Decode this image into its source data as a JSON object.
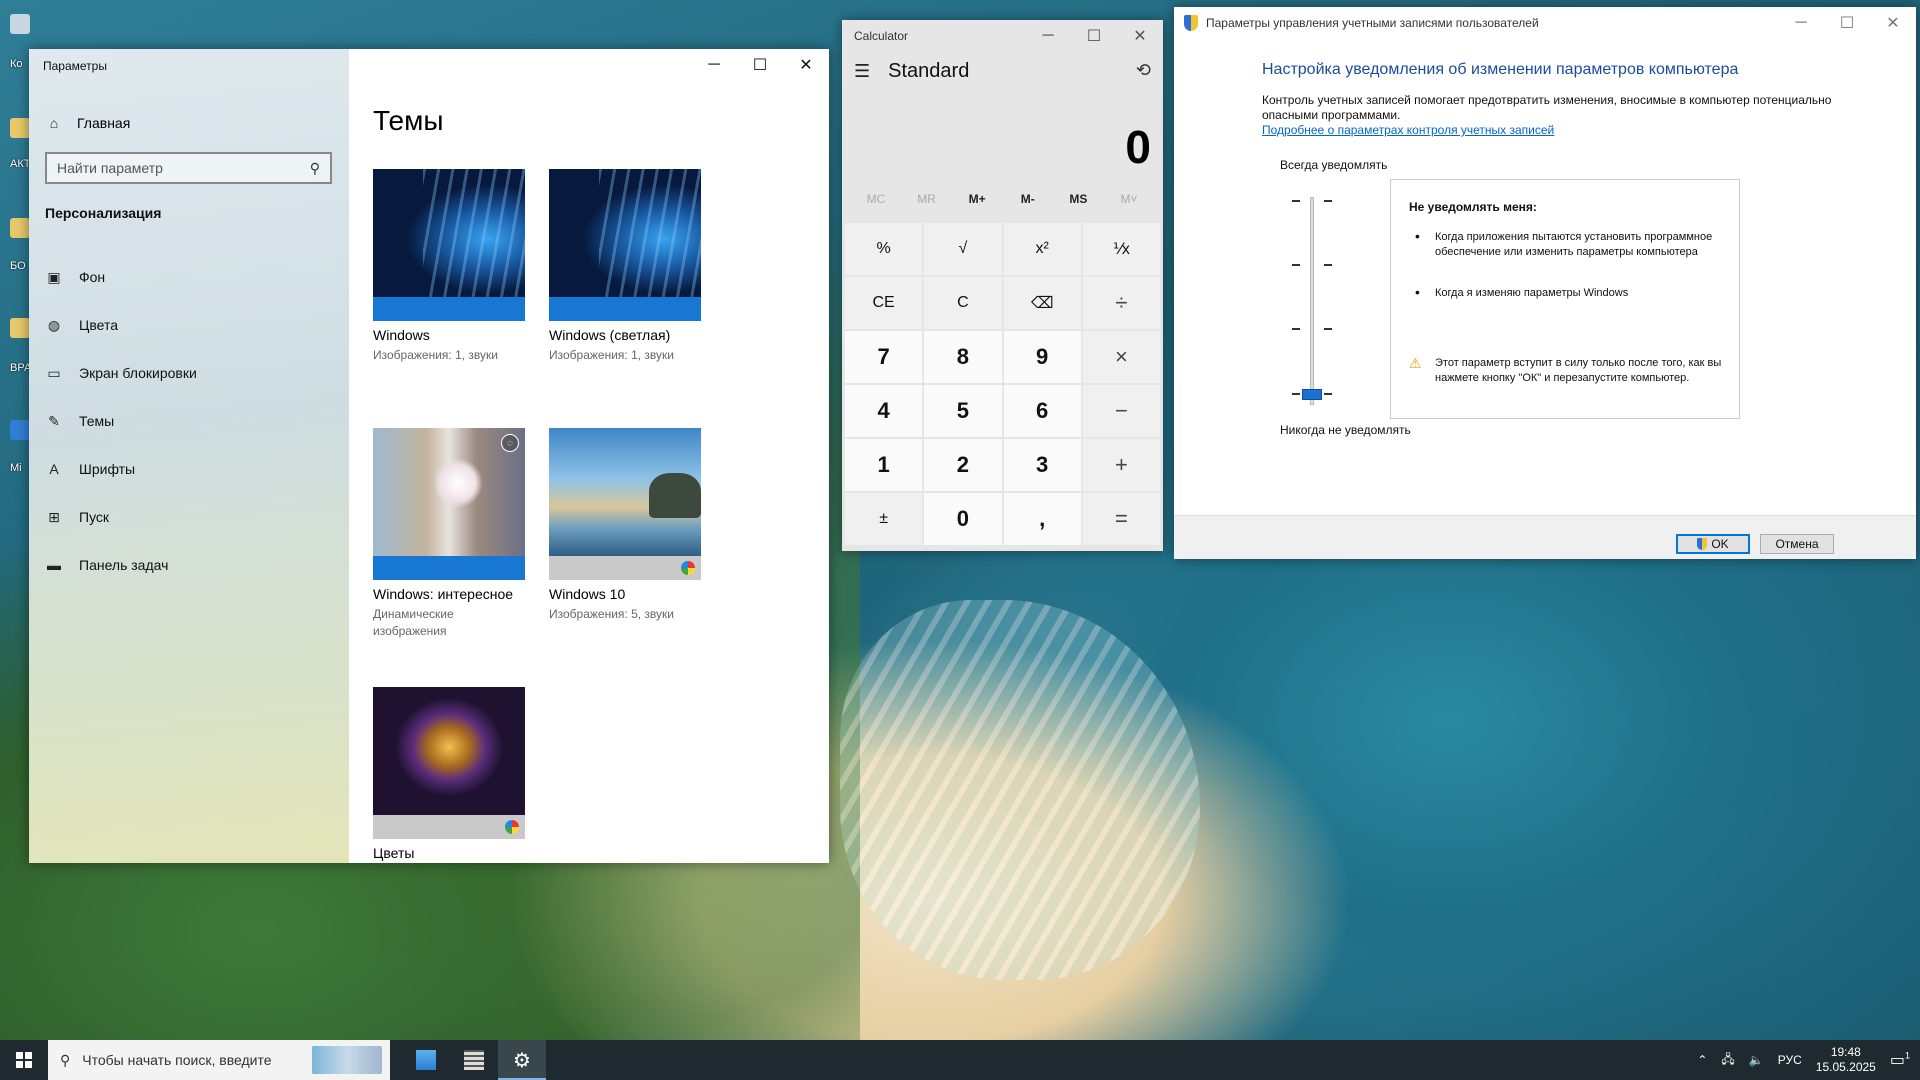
{
  "settings": {
    "title": "Параметры",
    "home": "Главная",
    "search_placeholder": "Найти параметр",
    "section": "Персонализация",
    "nav": [
      "Фон",
      "Цвета",
      "Экран блокировки",
      "Темы",
      "Шрифты",
      "Пуск",
      "Панель задач"
    ],
    "heading": "Темы",
    "themes": [
      {
        "name": "Windows",
        "sub": "Изображения: 1, звуки"
      },
      {
        "name": "Windows (светлая)",
        "sub": "Изображения: 1, звуки"
      },
      {
        "name": "Windows: интересное",
        "sub": "Динамические изображения"
      },
      {
        "name": "Windows 10",
        "sub": "Изображения: 5, звуки"
      },
      {
        "name": "Цветы",
        "sub": ""
      }
    ]
  },
  "calculator": {
    "title": "Calculator",
    "mode": "Standard",
    "display": "0",
    "memory": [
      "MC",
      "MR",
      "M+",
      "M-",
      "MS",
      "M˅"
    ],
    "keys": [
      "%",
      "√",
      "x²",
      "⅟x",
      "CE",
      "C",
      "⌫",
      "÷",
      "7",
      "8",
      "9",
      "×",
      "4",
      "5",
      "6",
      "−",
      "1",
      "2",
      "3",
      "+",
      "±",
      "0",
      ",",
      "="
    ]
  },
  "uac": {
    "title": "Параметры управления учетными записями пользователей",
    "heading": "Настройка уведомления об изменении параметров компьютера",
    "desc": "Контроль учетных записей помогает предотвратить изменения, вносимые в компьютер потенциально опасными программами.",
    "link": "Подробнее о параметрах контроля учетных записей",
    "always": "Всегда уведомлять",
    "never": "Никогда не уведомлять",
    "slider_level": 0,
    "box_title": "Не уведомлять меня:",
    "bullets": [
      "Когда приложения пытаются установить программное обеспечение или изменить параметры компьютера",
      "Когда я изменяю параметры Windows"
    ],
    "warning": "Этот параметр вступит в силу только после того, как вы нажмете кнопку \"ОК\" и перезапустите компьютер.",
    "ok": "OK",
    "cancel": "Отмена"
  },
  "taskbar": {
    "search_placeholder": "Чтобы начать поиск, введите",
    "lang": "РУС",
    "time": "19:48",
    "date": "15.05.2025",
    "notification_count": "1"
  },
  "desktop": {
    "labels": [
      "Ко",
      "АКТ",
      "БО",
      "ВРА",
      "Mi"
    ]
  },
  "colors": {
    "accent": "#1877d3",
    "uac_heading": "#1a4c9c",
    "link": "#0066cc",
    "taskbar": "#1f2a30"
  }
}
